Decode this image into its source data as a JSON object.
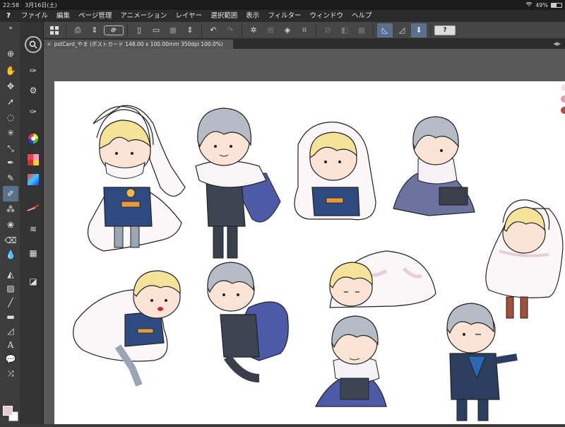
{
  "status": {
    "time": "22:58",
    "date": "3月16日(土)",
    "battery": "49%",
    "battery_level": 0.49
  },
  "menu": {
    "logo": "?",
    "items": [
      "ファイル",
      "編集",
      "ページ管理",
      "アニメーション",
      "レイヤー",
      "選択範囲",
      "表示",
      "フィルター",
      "ウィンドウ",
      "ヘルプ"
    ]
  },
  "toolbar": {
    "help_label": "?"
  },
  "lefttools": {
    "text_tool_glyph": "A"
  },
  "tab": {
    "title": "pstCard_やま (ポストカード 148.00 x 100.00mm 350dpi 100.0%)",
    "close_glyph": "×",
    "scroll_glyph": "◀▶"
  },
  "colors": {
    "foreground": "#e9c7cf",
    "background": "#ffffff",
    "selected_tool": "#5a6f8a"
  }
}
